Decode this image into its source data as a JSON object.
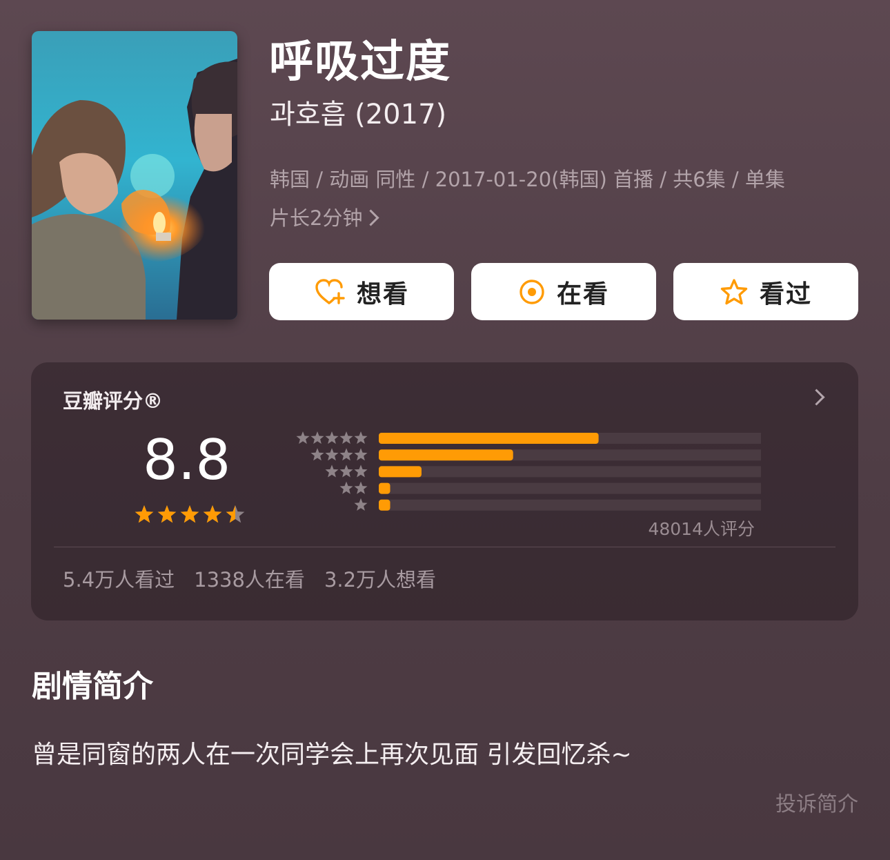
{
  "title": "呼吸过度",
  "subtitle": "과호흡 (2017)",
  "meta_line1": "韩国 / 动画 同性 / 2017-01-20(韩国) 首播 / 共6集 / 单集",
  "meta_line2": "片长2分钟",
  "actions": {
    "want": "想看",
    "watching": "在看",
    "watched": "看过"
  },
  "rating": {
    "label": "豆瓣评分®",
    "score": "8.8",
    "stars_value": 4.5,
    "distribution": [
      {
        "stars": 5,
        "percent": 54
      },
      {
        "stars": 4,
        "percent": 33
      },
      {
        "stars": 3,
        "percent": 10.5
      },
      {
        "stars": 2,
        "percent": 2.8
      },
      {
        "stars": 1,
        "percent": 2.8
      }
    ],
    "count_text": "48014人评分",
    "watched_text": "5.4万人看过",
    "watching_text": "1338人在看",
    "want_text": "3.2万人想看"
  },
  "synopsis": {
    "title": "剧情简介",
    "text": "曾是同窗的两人在一次同学会上再次见面 引发回忆杀~",
    "report": "投诉简介"
  },
  "colors": {
    "accent": "#ff9b05",
    "track": "#4a3b42",
    "gray_star": "#8e8388"
  }
}
